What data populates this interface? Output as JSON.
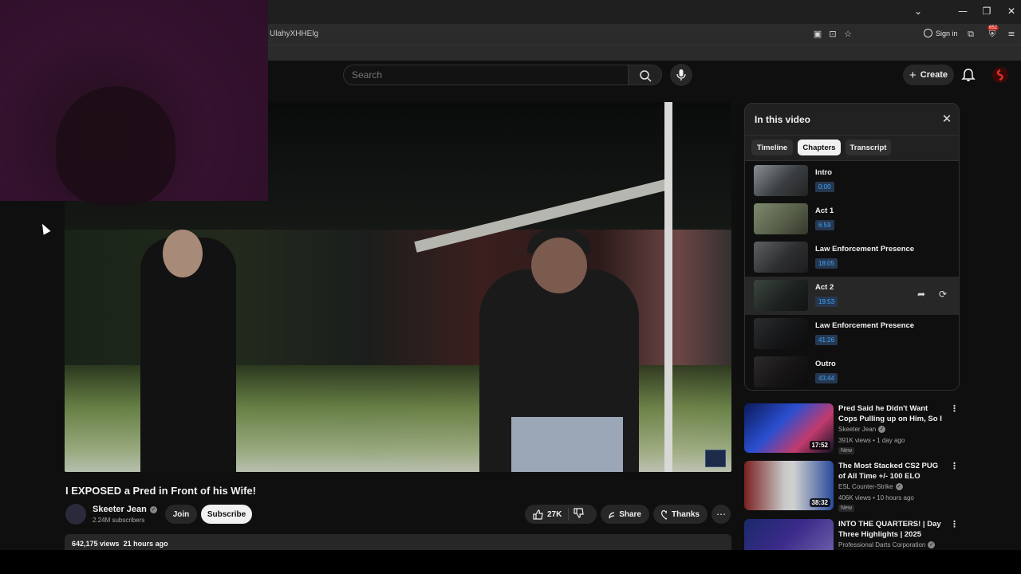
{
  "browser": {
    "url_fragment": "UlahyXHHElg",
    "sign_in": "Sign in",
    "extension_badge": "652"
  },
  "header": {
    "search_placeholder": "Search",
    "create_label": "Create"
  },
  "video": {
    "title": "I EXPOSED a Pred in Front of his Wife!",
    "channel": "Skeeter Jean",
    "subscribers": "2.24M subscribers",
    "join_label": "Join",
    "subscribe_label": "Subscribe",
    "likes": "27K",
    "share_label": "Share",
    "thanks_label": "Thanks",
    "views": "642,175 views",
    "posted": "21 hours ago"
  },
  "panel": {
    "title": "In this video",
    "tabs": [
      {
        "label": "Timeline"
      },
      {
        "label": "Chapters"
      },
      {
        "label": "Transcript"
      }
    ],
    "chapters": [
      {
        "title": "Intro",
        "time": "0:00"
      },
      {
        "title": "Act 1",
        "time": "6:59"
      },
      {
        "title": "Law Enforcement Presence",
        "time": "18:05"
      },
      {
        "title": "Act 2",
        "time": "19:53"
      },
      {
        "title": "Law Enforcement Presence",
        "time": "41:26"
      },
      {
        "title": "Outro",
        "time": "43:44"
      }
    ]
  },
  "recommendations": [
    {
      "title": "Pred Said he Didn't Want Cops Pulling up on Him, So I had the...",
      "channel": "Skeeter Jean",
      "meta": "391K views • 1 day ago",
      "badge": "New",
      "duration": "17:52"
    },
    {
      "title": "The Most Stacked CS2 PUG of All Time +/- 100 ELO",
      "channel": "ESL Counter-Strike",
      "meta": "406K views • 10 hours ago",
      "badge": "New",
      "duration": "38:32"
    },
    {
      "title": "INTO THE QUARTERS! | Day Three Highlights | 2025 BOYLE...",
      "channel": "Professional Darts Corporation",
      "meta": "",
      "badge": "",
      "duration": ""
    }
  ]
}
